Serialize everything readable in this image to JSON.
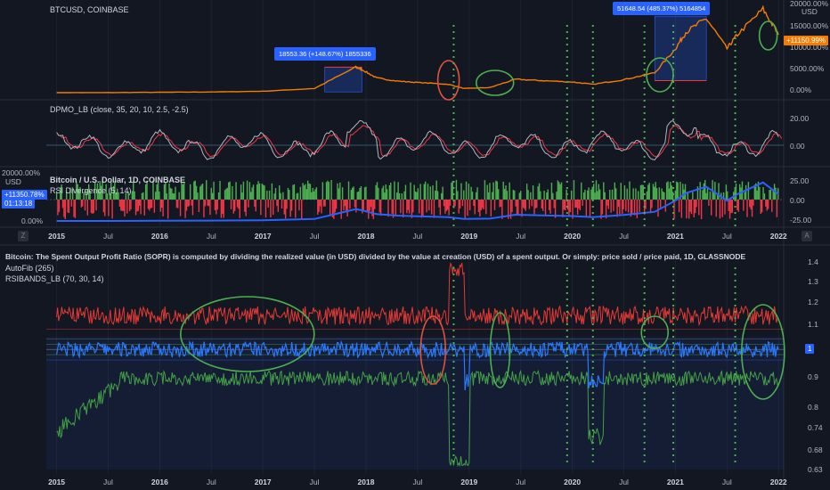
{
  "panes": {
    "btc": {
      "title": "BTCUSD, COINBASE",
      "axis_unit": "USD",
      "yticks": [
        {
          "label": "20000.00%",
          "v": 20000
        },
        {
          "label": "15000.00%",
          "v": 15000
        },
        {
          "label": "10000.00%",
          "v": 10000
        },
        {
          "label": "5000.00%",
          "v": 5000
        },
        {
          "label": "0.00%",
          "v": 0
        }
      ],
      "price_badge": "+11150.99%",
      "callout_left": "18553.36 (+148.67%) 1855336",
      "callout_right": "51648.54 (485.37%) 5164854"
    },
    "dpmo": {
      "title": "DPMO_LB (close, 35, 20, 10, 2.5, -2.5)",
      "yticks": [
        {
          "label": "20.00",
          "v": 20
        },
        {
          "label": "0.00",
          "v": 0
        }
      ]
    },
    "rsi": {
      "title": "Bitcoin / U.S. Dollar, 1D, COINBASE",
      "subtitle": "RSI Divergence (5, 14)",
      "left_axis_top": "20000.00%",
      "left_axis_unit": "USD",
      "left_axis_bottom": "0.00%",
      "badge_pct": "+11350.78%",
      "badge_time": "01:13:18",
      "yticks": [
        {
          "label": "25.00",
          "v": 25
        },
        {
          "label": "0.00",
          "v": 0
        },
        {
          "label": "-25.00",
          "v": -25
        }
      ]
    },
    "sopr": {
      "title": "Bitcoin: The Spent Output Profit Ratio (SOPR) is computed by dividing the realized value (in USD) divided by the value at creation (USD) of a spent output. Or simply: price sold / price paid, 1D, GLASSNODE",
      "indicator1": "AutoFib (265)",
      "indicator2": "RSIBANDS_LB (70, 30, 14)",
      "yticks": [
        {
          "label": "1.4",
          "v": 1.4
        },
        {
          "label": "1.3",
          "v": 1.3
        },
        {
          "label": "1.2",
          "v": 1.2
        },
        {
          "label": "1.1",
          "v": 1.1
        },
        {
          "label": "0.9",
          "v": 0.9
        },
        {
          "label": "0.8",
          "v": 0.8
        },
        {
          "label": "0.74",
          "v": 0.74
        },
        {
          "label": "0.68",
          "v": 0.68
        },
        {
          "label": "0.63",
          "v": 0.63
        }
      ],
      "value_badge": "1"
    }
  },
  "xaxis": {
    "labels": [
      {
        "label": "2015",
        "t": 2015.0,
        "year": true
      },
      {
        "label": "Jul",
        "t": 2015.5,
        "year": false
      },
      {
        "label": "2016",
        "t": 2016.0,
        "year": true
      },
      {
        "label": "Jul",
        "t": 2016.5,
        "year": false
      },
      {
        "label": "2017",
        "t": 2017.0,
        "year": true
      },
      {
        "label": "Jul",
        "t": 2017.5,
        "year": false
      },
      {
        "label": "2018",
        "t": 2018.0,
        "year": true
      },
      {
        "label": "Jul",
        "t": 2018.5,
        "year": false
      },
      {
        "label": "2019",
        "t": 2019.0,
        "year": true
      },
      {
        "label": "Jul",
        "t": 2019.5,
        "year": false
      },
      {
        "label": "2020",
        "t": 2020.0,
        "year": true
      },
      {
        "label": "Jul",
        "t": 2020.5,
        "year": false
      },
      {
        "label": "2021",
        "t": 2021.0,
        "year": true
      },
      {
        "label": "Jul",
        "t": 2021.5,
        "year": false
      },
      {
        "label": "2022",
        "t": 2022.0,
        "year": true
      }
    ],
    "left_icon": "Z",
    "right_icon": "A"
  },
  "markers": [
    2018.85,
    2019.95,
    2020.2,
    2020.7,
    2020.98,
    2021.58
  ],
  "chart_data": [
    {
      "type": "line",
      "title": "BTCUSD, COINBASE",
      "ylabel": "USD",
      "series": [
        {
          "name": "BTCUSD",
          "x": [
            2015.0,
            2015.5,
            2016.0,
            2016.5,
            2017.0,
            2017.5,
            2017.9,
            2017.96,
            2018.1,
            2018.3,
            2018.5,
            2018.8,
            2018.95,
            2019.2,
            2019.45,
            2019.7,
            2020.0,
            2020.2,
            2020.5,
            2020.8,
            2021.0,
            2021.1,
            2021.3,
            2021.5,
            2021.6,
            2021.85,
            2022.0
          ],
          "y": [
            0,
            20,
            80,
            150,
            300,
            900,
            5500,
            5000,
            3200,
            2500,
            2200,
            1800,
            900,
            1100,
            2900,
            2600,
            2300,
            1800,
            2800,
            4300,
            9500,
            13000,
            16000,
            9500,
            12500,
            18000,
            12500
          ]
        }
      ]
    },
    {
      "type": "line",
      "title": "DPMO_LB (close, 35, 20, 10, 2.5, -2.5)",
      "ylim": [
        -12,
        28
      ]
    },
    {
      "type": "bar",
      "title": "RSI Divergence (5, 14)",
      "ylim": [
        -25,
        25
      ]
    },
    {
      "type": "line",
      "title": "SOPR, 1D, GLASSNODE",
      "ylim": [
        0.63,
        1.4
      ]
    }
  ]
}
